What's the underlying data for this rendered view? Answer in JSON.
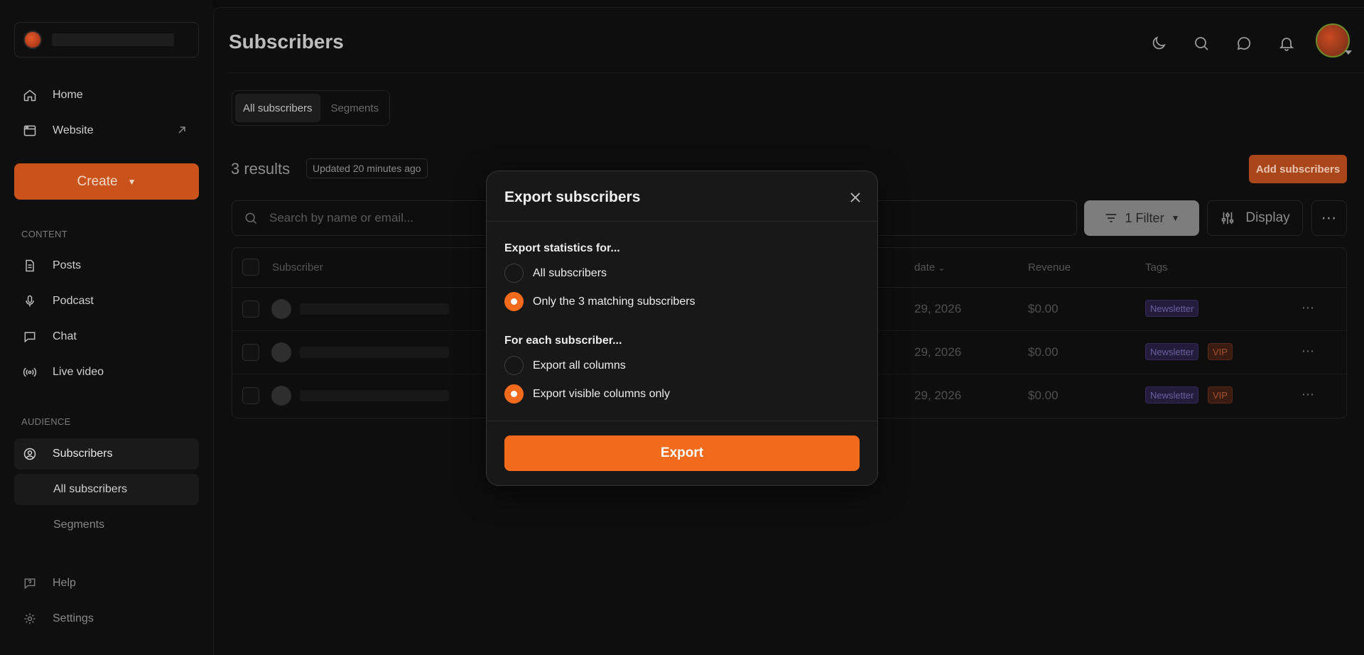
{
  "sidebar": {
    "nav": [
      {
        "label": "Home",
        "icon": "home-icon"
      },
      {
        "label": "Website",
        "icon": "browser-icon"
      }
    ],
    "create_label": "Create",
    "content_label": "CONTENT",
    "content_items": [
      {
        "label": "Posts",
        "icon": "document-icon"
      },
      {
        "label": "Podcast",
        "icon": "microphone-icon"
      },
      {
        "label": "Chat",
        "icon": "chat-icon"
      },
      {
        "label": "Live video",
        "icon": "broadcast-icon"
      }
    ],
    "audience_label": "AUDIENCE",
    "subscribers_label": "Subscribers",
    "sub_items": [
      {
        "label": "All subscribers"
      },
      {
        "label": "Segments"
      }
    ],
    "help_label": "Help",
    "settings_label": "Settings"
  },
  "header": {
    "title": "Subscribers"
  },
  "tabs": [
    {
      "label": "All subscribers"
    },
    {
      "label": "Segments"
    }
  ],
  "toolbar": {
    "results": "3 results",
    "updated": "Updated 20 minutes ago",
    "add_label": "Add subscribers",
    "search_placeholder": "Search by name or email...",
    "filter_label": "1 Filter",
    "display_label": "Display",
    "more_label": "⋯"
  },
  "table": {
    "columns": [
      "Subscriber",
      "date",
      "Revenue",
      "Tags"
    ],
    "rows": [
      {
        "date": "29, 2026",
        "revenue": "$0.00",
        "tags": [
          "Newsletter"
        ]
      },
      {
        "date": "29, 2026",
        "revenue": "$0.00",
        "tags": [
          "Newsletter",
          "VIP"
        ]
      },
      {
        "date": "29, 2026",
        "revenue": "$0.00",
        "tags": [
          "Newsletter",
          "VIP"
        ]
      }
    ],
    "row_more": "⋯"
  },
  "modal": {
    "title": "Export subscribers",
    "stats_label": "Export statistics for...",
    "stats_options": [
      {
        "label": "All subscribers",
        "selected": false
      },
      {
        "label": "Only the 3 matching subscribers",
        "selected": true
      }
    ],
    "columns_label": "For each subscriber...",
    "columns_options": [
      {
        "label": "Export all columns",
        "selected": false
      },
      {
        "label": "Export visible columns only",
        "selected": true
      }
    ],
    "export_label": "Export"
  },
  "colors": {
    "accent": "#f26b1d",
    "create_bg": "#c9531b",
    "tag_newsletter": "#6d5fa3",
    "tag_vip": "#a4502c"
  }
}
